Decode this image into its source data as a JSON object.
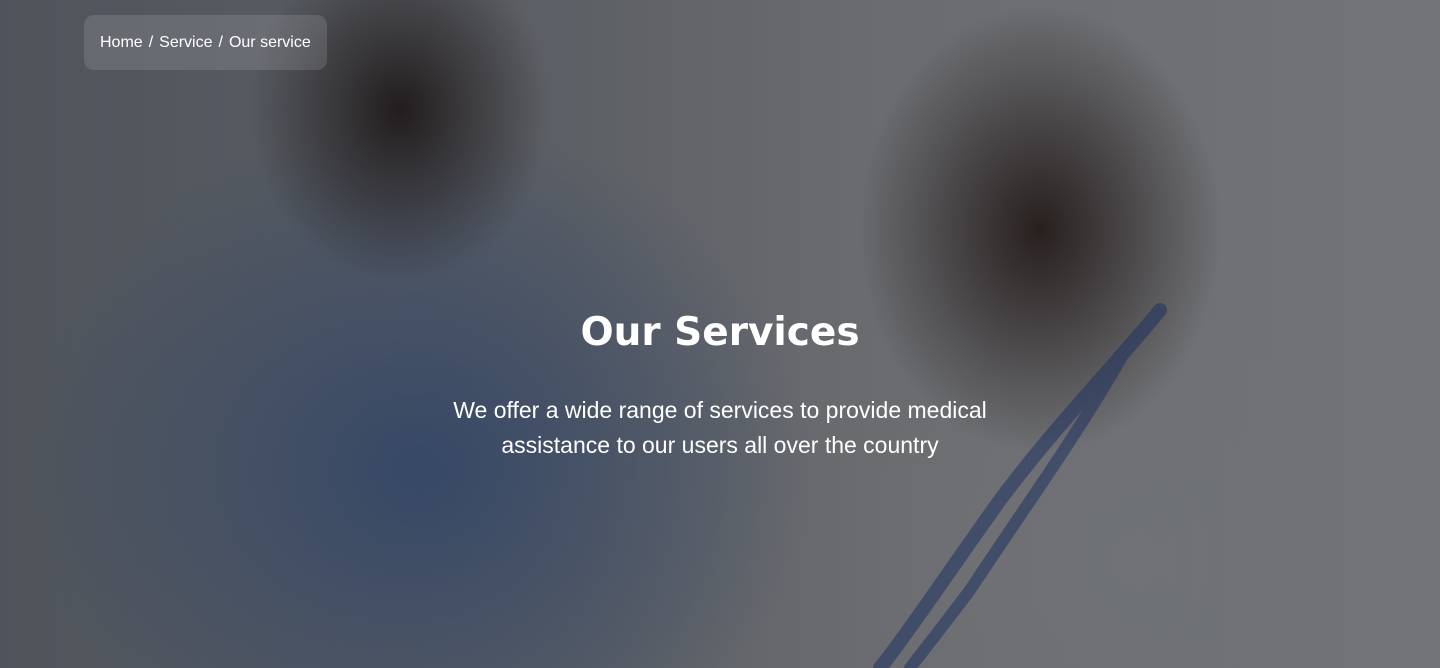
{
  "breadcrumb": {
    "items": [
      "Home",
      "Service",
      "Our service"
    ],
    "separator": "/"
  },
  "hero": {
    "title": "Our Services",
    "subtitle_line1": "We offer a wide range of services to provide medical",
    "subtitle_line2": "assistance to our users all over the country",
    "background_image": "medical-staff-photo",
    "overlay_color": "#12141a"
  }
}
